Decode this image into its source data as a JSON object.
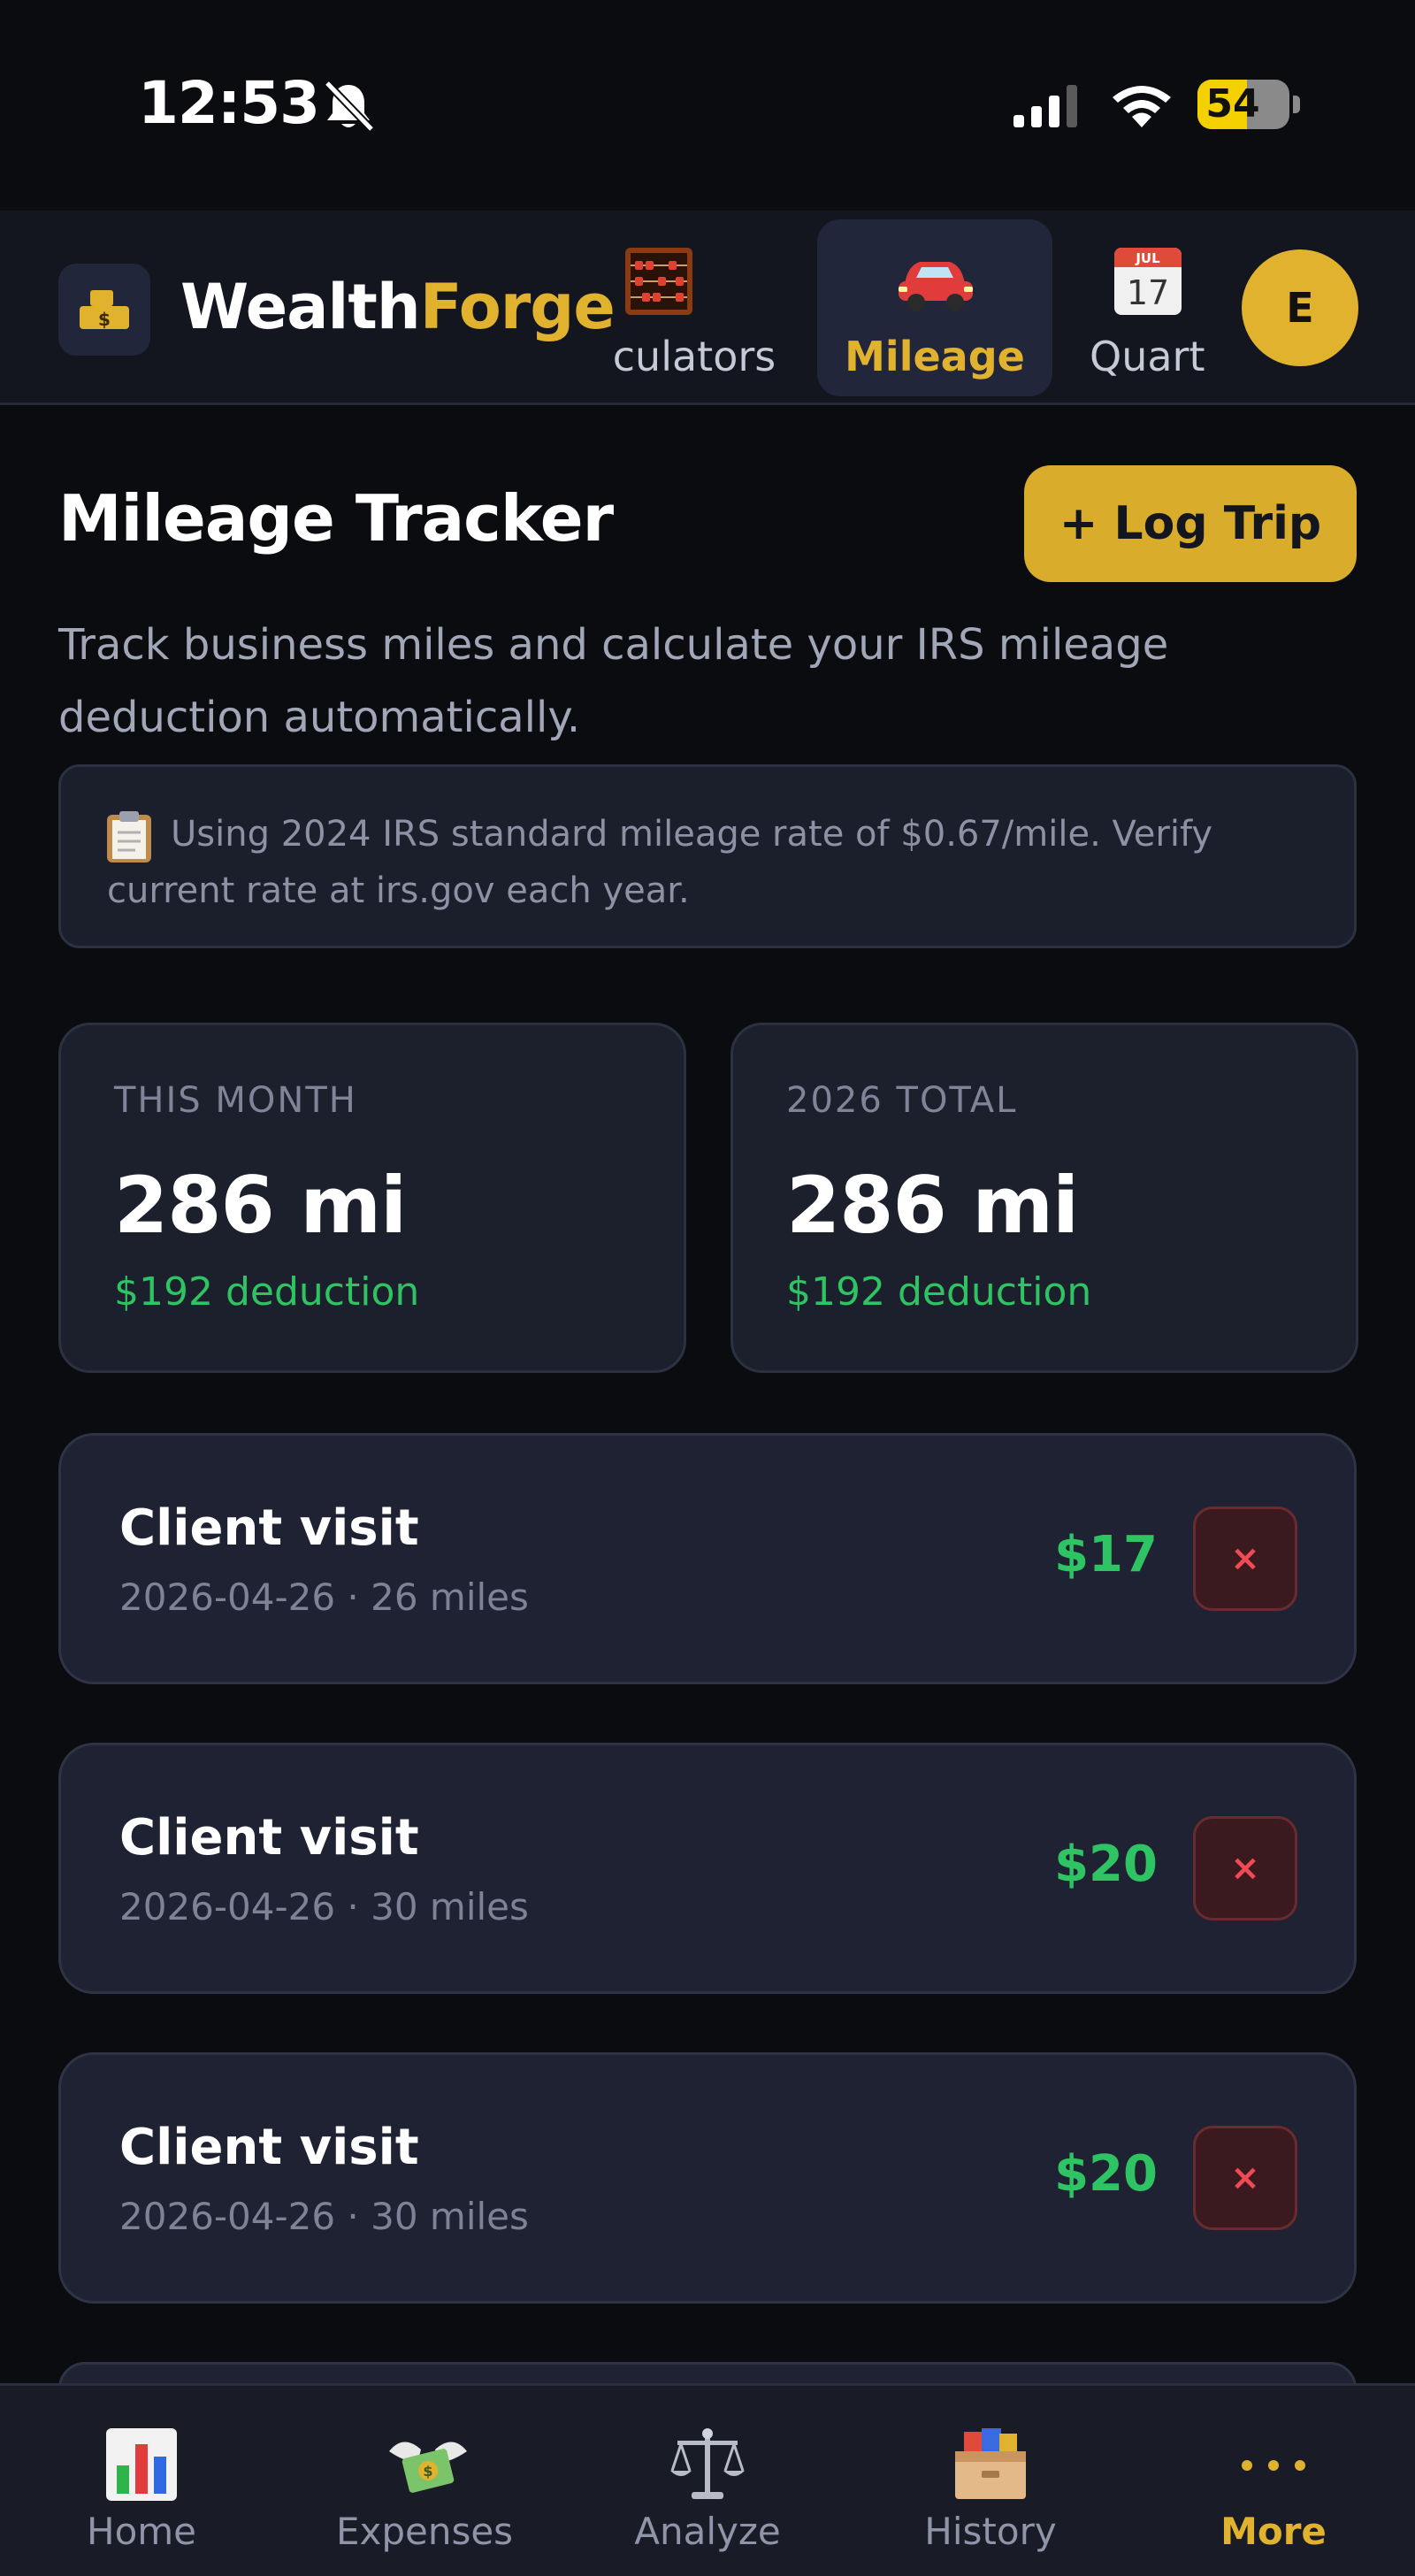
{
  "status_bar": {
    "time": "12:53",
    "battery": "54",
    "battery_level_percent": 54
  },
  "header": {
    "brand_part1": "Wealth",
    "brand_part2": "Forge",
    "nav_tabs": [
      {
        "label": "culators",
        "icon": "abacus-icon"
      },
      {
        "label": "Mileage",
        "icon": "car-icon",
        "active": true
      },
      {
        "label": "Quart",
        "icon": "calendar-icon"
      }
    ],
    "calendar_month": "JUL",
    "calendar_day": "17",
    "avatar_initial": "E"
  },
  "main": {
    "title": "Mileage Tracker",
    "log_trip_label": "+ Log Trip",
    "subtitle": "Track business miles and calculate your IRS mileage deduction automatically.",
    "info": "Using 2024 IRS standard mileage rate of $0.67/mile. Verify current rate at irs.gov each year.",
    "stats": [
      {
        "label": "THIS MONTH",
        "value": "286 mi",
        "sub": "$192 deduction"
      },
      {
        "label": "2026 TOTAL",
        "value": "286 mi",
        "sub": "$192 deduction"
      }
    ],
    "trips": [
      {
        "title": "Client visit",
        "meta": "2026-04-26 · 26 miles",
        "amount": "$17",
        "delete": "×"
      },
      {
        "title": "Client visit",
        "meta": "2026-04-26 · 30 miles",
        "amount": "$20",
        "delete": "×"
      },
      {
        "title": "Client visit",
        "meta": "2026-04-26 · 30 miles",
        "amount": "$20",
        "delete": "×"
      }
    ]
  },
  "bottom_nav": [
    {
      "label": "Home",
      "icon": "bar-chart-icon"
    },
    {
      "label": "Expenses",
      "icon": "money-wings-icon"
    },
    {
      "label": "Analyze",
      "icon": "scales-icon"
    },
    {
      "label": "History",
      "icon": "card-box-icon"
    },
    {
      "label": "More",
      "icon": "more-dots-icon",
      "active": true
    }
  ],
  "colors": {
    "accent": "#e0b22e",
    "positive": "#2fc463",
    "danger": "#ef4a55",
    "background": "#0b0c10"
  }
}
